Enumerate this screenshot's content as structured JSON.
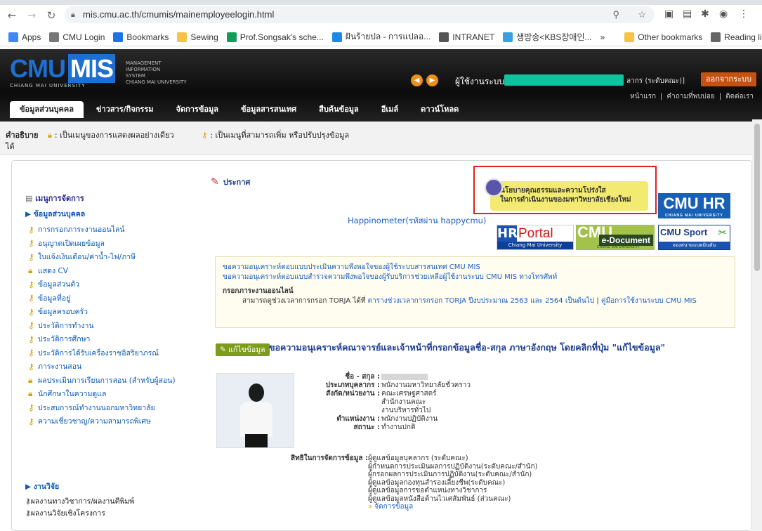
{
  "browser": {
    "url": "mis.cmu.ac.th/cmumis/mainemployeelogin.html",
    "bookmarks": [
      {
        "label": "Apps",
        "icon": "apps-icon",
        "color": "#4285f4"
      },
      {
        "label": "CMU Login",
        "icon": "globe-icon",
        "color": "#777777"
      },
      {
        "label": "Bookmarks",
        "icon": "star-icon",
        "color": "#1a73e8"
      },
      {
        "label": "Sewing",
        "icon": "folder-icon",
        "color": "#f6c344"
      },
      {
        "label": "Prof.Songsak's sche...",
        "icon": "sheet-icon",
        "color": "#0f9d58"
      },
      {
        "label": "ฝันร้ายปล - การแปลอ...",
        "icon": "bird-icon",
        "color": "#1e88e5"
      },
      {
        "label": "INTRANET",
        "icon": "globe-icon",
        "color": "#555555"
      },
      {
        "label": "생방송<KBS장애인...",
        "icon": "kbs-icon",
        "color": "#3aa0e0"
      },
      {
        "label": "»",
        "icon": "",
        "color": ""
      },
      {
        "label": "Other bookmarks",
        "icon": "folder-icon",
        "color": "#f6c344"
      },
      {
        "label": "Reading list",
        "icon": "reading-list-icon",
        "color": "#666666"
      }
    ]
  },
  "header": {
    "logo_cmu": "CMU",
    "logo_mis": "MIS",
    "logo_university": "CHIANG MAI UNIVERSITY",
    "logo_lines": [
      "MANAGEMENT",
      "INFORMATION",
      "SYSTEM",
      "CHIANG MAI UNIVERSITY"
    ],
    "user_label": "ผู้ใช้งานระบบ :",
    "user_role": "ลากร (ระดับคณะ)]",
    "logout": "ออกจากระบบ",
    "toplinks": [
      "หน้าแรก",
      "|",
      "คำถามที่พบบ่อย",
      "|",
      "ติดต่อเรา"
    ],
    "menu": [
      "ข้อมูลส่วนบุคคล",
      "ข่าวสาร/กิจกรรม",
      "จัดการข้อมูล",
      "ข้อมูลสารสนเทศ",
      "สืบค้นข้อมูล",
      "อีเมล์",
      "ดาวน์โหลด"
    ]
  },
  "legend": {
    "label": "คำอธิบาย",
    "suffix": "ได้",
    "lock_text": ": เป็นเมนูของการแสดงผลอย่างเดียว",
    "key_text": ": เป็นเมนูที่สามารถเพิ่ม หรือปรับปรุงข้อมูล"
  },
  "sidebar": {
    "title": "เมนูการจัดการ",
    "section": "ข้อมูลส่วนบุคคล",
    "items": [
      {
        "label": "การกรอกภาระงานออนไลน์",
        "icon": "key-icon"
      },
      {
        "label": "อนุญาตเปิดเผยข้อมูล",
        "icon": "key-icon"
      },
      {
        "label": "ใบแจ้งเงินเดือน/ค่าน้ำ-ไฟ/ภาษี",
        "icon": "key-icon"
      },
      {
        "label": "แสดง CV",
        "icon": "lock-icon"
      },
      {
        "label": "ข้อมูลส่วนตัว",
        "icon": "key-icon"
      },
      {
        "label": "ข้อมูลที่อยู่",
        "icon": "key-icon"
      },
      {
        "label": "ข้อมูลครอบครัว",
        "icon": "key-icon"
      },
      {
        "label": "ประวัติการทำงาน",
        "icon": "key-icon"
      },
      {
        "label": "ประวัติการศึกษา",
        "icon": "key-icon"
      },
      {
        "label": "ประวัติการได้รับเครื่องราชอิสริยาภรณ์",
        "icon": "key-icon"
      },
      {
        "label": "ภาระงานสอน",
        "icon": "key-icon"
      },
      {
        "label": "ผลประเมินการเรียนการสอน (สำหรับผู้สอน)",
        "icon": "lock-icon"
      },
      {
        "label": "นักศึกษาในความดูแล",
        "icon": "lock-icon"
      },
      {
        "label": "ประสบการณ์ทำงานนอกมหาวิทยาลัย",
        "icon": "key-icon"
      },
      {
        "label": "ความเชี่ยวชาญ/ความสามารถพิเศษ",
        "icon": "key-icon"
      }
    ],
    "research_section": "งานวิจัย",
    "research_items": [
      {
        "label": "ผลงานทางวิชาการ/ผลงานตีพิมพ์",
        "icon": "key-icon"
      },
      {
        "label": "ผลงานวิจัยเชิงโครงการ",
        "icon": "key-icon"
      }
    ]
  },
  "main": {
    "announce": "ประกาศ",
    "happinometer": "Happinometer(รหัสผ่าน happycmu)",
    "policy_line1": "นโยบายคุณธรรมและความโปร่งใส",
    "policy_line2": "ในการดำเนินงานของมหาวิทยาลัยเชียงใหม่",
    "cmuhr": "CMU HR",
    "cmuhr_sub": "CHIANG MAI UNIVERSITY",
    "hrportal_a": "HR",
    "hrportal_b": "Portal",
    "hrportal_c": "Chiang Mai University",
    "edoc_a": "CMU",
    "edoc_b": "e-Document",
    "edoc_c": "CHIANG MAI UNIVERSITY",
    "sport_a": "CMU Sport",
    "sport_b": "จองสนามแบดมินตัน",
    "notice": {
      "line1": "ขอความอนุเคราะห์ตอบแบบประเมินความพึงพอใจของผู้ใช้ระบบสารสนเทศ CMU MIS",
      "line2": "ขอความอนุเคราะห์ตอบแบบสำรวจความพึงพอใจของผู้รับบริการช่วยเหลือผู้ใช้งานระบบ CMU MIS ทางโทรศัพท์",
      "heading": "กรอกภาระงานออนไลน์",
      "body_pre": "สามารถดูช่วงเวลาการกรอก TORJA ได้ที่ ",
      "body_link1": "ตารางช่วงเวลาการกรอก TORJA ปีงบประมาณ 2563 และ 2564 เป็นต้นไป",
      "body_sep": " | ",
      "body_link2": "คู่มือการใช้งานระบบ CMU MIS"
    },
    "edit_button": "แก้ไขข้อมูล",
    "edit_text": "ขอความอนุเคราะห์คณาจารย์และเจ้าหน้าที่กรอกข้อมูลชื่อ-สกุล ภาษาอังกฤษ โดยคลิกที่ปุ่ม \"แก้ไขข้อมูล\"",
    "profile": {
      "name_label": "ชื่อ - สกุล :",
      "type_label": "ประเภทบุคลากร :",
      "type_value": "พนักงานมหาวิทยาลัยชั่วคราว",
      "dept_label": "สังกัด/หน่วยงาน :",
      "dept_value1": "คณะเศรษฐศาสตร์",
      "dept_value2": "สำนักงานคณะ",
      "dept_value3": "งานบริหารทั่วไป",
      "pos_label": "ตำแหน่งงาน :",
      "pos_value": "พนักงานปฏิบัติงาน",
      "status_label": "สถานะ :",
      "status_value": "ทำงานปกติ"
    },
    "rights": {
      "label": "สิทธิในการจัดการข้อมูล :",
      "items": [
        "ผู้ดูแลข้อมูลบุคลากร (ระดับคณะ)",
        "ผู้กำหนดการประเมินผลการปฏิบัติงาน(ระดับคณะ/สำนัก)",
        "ผู้กรอกผลการประเมินการปฏิบัติงาน(ระดับคณะ/สำนัก)",
        "ผู้ดูแลข้อมูลกองทุนสำรองเลี้ยงชีพ(ระดับคณะ)",
        "ผู้ดูแลข้อมูลการขอตำแหน่งทางวิชาการ",
        "ผู้ดูแลข้อมูลหนังสือด้านไวเศสัมพันธ์ (ส่วนคณะ)"
      ],
      "manage": "จัดการข้อมูล"
    }
  }
}
